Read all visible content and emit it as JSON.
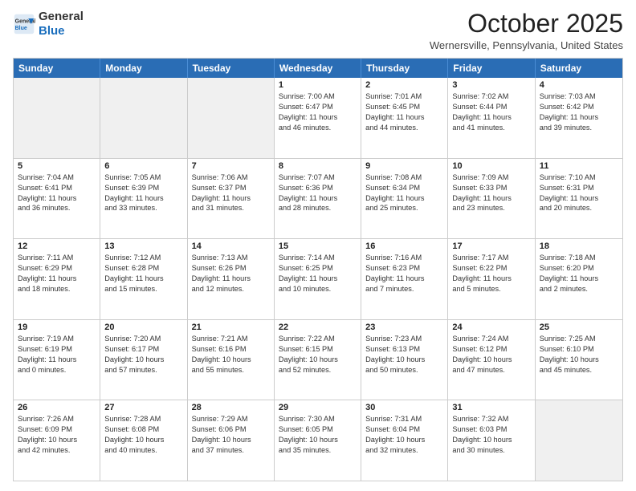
{
  "header": {
    "logo_general": "General",
    "logo_blue": "Blue",
    "month": "October 2025",
    "location": "Wernersville, Pennsylvania, United States"
  },
  "days_of_week": [
    "Sunday",
    "Monday",
    "Tuesday",
    "Wednesday",
    "Thursday",
    "Friday",
    "Saturday"
  ],
  "weeks": [
    [
      {
        "day": "",
        "info": "",
        "shaded": true
      },
      {
        "day": "",
        "info": "",
        "shaded": true
      },
      {
        "day": "",
        "info": "",
        "shaded": true
      },
      {
        "day": "1",
        "info": "Sunrise: 7:00 AM\nSunset: 6:47 PM\nDaylight: 11 hours\nand 46 minutes.",
        "shaded": false
      },
      {
        "day": "2",
        "info": "Sunrise: 7:01 AM\nSunset: 6:45 PM\nDaylight: 11 hours\nand 44 minutes.",
        "shaded": false
      },
      {
        "day": "3",
        "info": "Sunrise: 7:02 AM\nSunset: 6:44 PM\nDaylight: 11 hours\nand 41 minutes.",
        "shaded": false
      },
      {
        "day": "4",
        "info": "Sunrise: 7:03 AM\nSunset: 6:42 PM\nDaylight: 11 hours\nand 39 minutes.",
        "shaded": false
      }
    ],
    [
      {
        "day": "5",
        "info": "Sunrise: 7:04 AM\nSunset: 6:41 PM\nDaylight: 11 hours\nand 36 minutes.",
        "shaded": false
      },
      {
        "day": "6",
        "info": "Sunrise: 7:05 AM\nSunset: 6:39 PM\nDaylight: 11 hours\nand 33 minutes.",
        "shaded": false
      },
      {
        "day": "7",
        "info": "Sunrise: 7:06 AM\nSunset: 6:37 PM\nDaylight: 11 hours\nand 31 minutes.",
        "shaded": false
      },
      {
        "day": "8",
        "info": "Sunrise: 7:07 AM\nSunset: 6:36 PM\nDaylight: 11 hours\nand 28 minutes.",
        "shaded": false
      },
      {
        "day": "9",
        "info": "Sunrise: 7:08 AM\nSunset: 6:34 PM\nDaylight: 11 hours\nand 25 minutes.",
        "shaded": false
      },
      {
        "day": "10",
        "info": "Sunrise: 7:09 AM\nSunset: 6:33 PM\nDaylight: 11 hours\nand 23 minutes.",
        "shaded": false
      },
      {
        "day": "11",
        "info": "Sunrise: 7:10 AM\nSunset: 6:31 PM\nDaylight: 11 hours\nand 20 minutes.",
        "shaded": false
      }
    ],
    [
      {
        "day": "12",
        "info": "Sunrise: 7:11 AM\nSunset: 6:29 PM\nDaylight: 11 hours\nand 18 minutes.",
        "shaded": false
      },
      {
        "day": "13",
        "info": "Sunrise: 7:12 AM\nSunset: 6:28 PM\nDaylight: 11 hours\nand 15 minutes.",
        "shaded": false
      },
      {
        "day": "14",
        "info": "Sunrise: 7:13 AM\nSunset: 6:26 PM\nDaylight: 11 hours\nand 12 minutes.",
        "shaded": false
      },
      {
        "day": "15",
        "info": "Sunrise: 7:14 AM\nSunset: 6:25 PM\nDaylight: 11 hours\nand 10 minutes.",
        "shaded": false
      },
      {
        "day": "16",
        "info": "Sunrise: 7:16 AM\nSunset: 6:23 PM\nDaylight: 11 hours\nand 7 minutes.",
        "shaded": false
      },
      {
        "day": "17",
        "info": "Sunrise: 7:17 AM\nSunset: 6:22 PM\nDaylight: 11 hours\nand 5 minutes.",
        "shaded": false
      },
      {
        "day": "18",
        "info": "Sunrise: 7:18 AM\nSunset: 6:20 PM\nDaylight: 11 hours\nand 2 minutes.",
        "shaded": false
      }
    ],
    [
      {
        "day": "19",
        "info": "Sunrise: 7:19 AM\nSunset: 6:19 PM\nDaylight: 11 hours\nand 0 minutes.",
        "shaded": false
      },
      {
        "day": "20",
        "info": "Sunrise: 7:20 AM\nSunset: 6:17 PM\nDaylight: 10 hours\nand 57 minutes.",
        "shaded": false
      },
      {
        "day": "21",
        "info": "Sunrise: 7:21 AM\nSunset: 6:16 PM\nDaylight: 10 hours\nand 55 minutes.",
        "shaded": false
      },
      {
        "day": "22",
        "info": "Sunrise: 7:22 AM\nSunset: 6:15 PM\nDaylight: 10 hours\nand 52 minutes.",
        "shaded": false
      },
      {
        "day": "23",
        "info": "Sunrise: 7:23 AM\nSunset: 6:13 PM\nDaylight: 10 hours\nand 50 minutes.",
        "shaded": false
      },
      {
        "day": "24",
        "info": "Sunrise: 7:24 AM\nSunset: 6:12 PM\nDaylight: 10 hours\nand 47 minutes.",
        "shaded": false
      },
      {
        "day": "25",
        "info": "Sunrise: 7:25 AM\nSunset: 6:10 PM\nDaylight: 10 hours\nand 45 minutes.",
        "shaded": false
      }
    ],
    [
      {
        "day": "26",
        "info": "Sunrise: 7:26 AM\nSunset: 6:09 PM\nDaylight: 10 hours\nand 42 minutes.",
        "shaded": false
      },
      {
        "day": "27",
        "info": "Sunrise: 7:28 AM\nSunset: 6:08 PM\nDaylight: 10 hours\nand 40 minutes.",
        "shaded": false
      },
      {
        "day": "28",
        "info": "Sunrise: 7:29 AM\nSunset: 6:06 PM\nDaylight: 10 hours\nand 37 minutes.",
        "shaded": false
      },
      {
        "day": "29",
        "info": "Sunrise: 7:30 AM\nSunset: 6:05 PM\nDaylight: 10 hours\nand 35 minutes.",
        "shaded": false
      },
      {
        "day": "30",
        "info": "Sunrise: 7:31 AM\nSunset: 6:04 PM\nDaylight: 10 hours\nand 32 minutes.",
        "shaded": false
      },
      {
        "day": "31",
        "info": "Sunrise: 7:32 AM\nSunset: 6:03 PM\nDaylight: 10 hours\nand 30 minutes.",
        "shaded": false
      },
      {
        "day": "",
        "info": "",
        "shaded": true
      }
    ]
  ]
}
